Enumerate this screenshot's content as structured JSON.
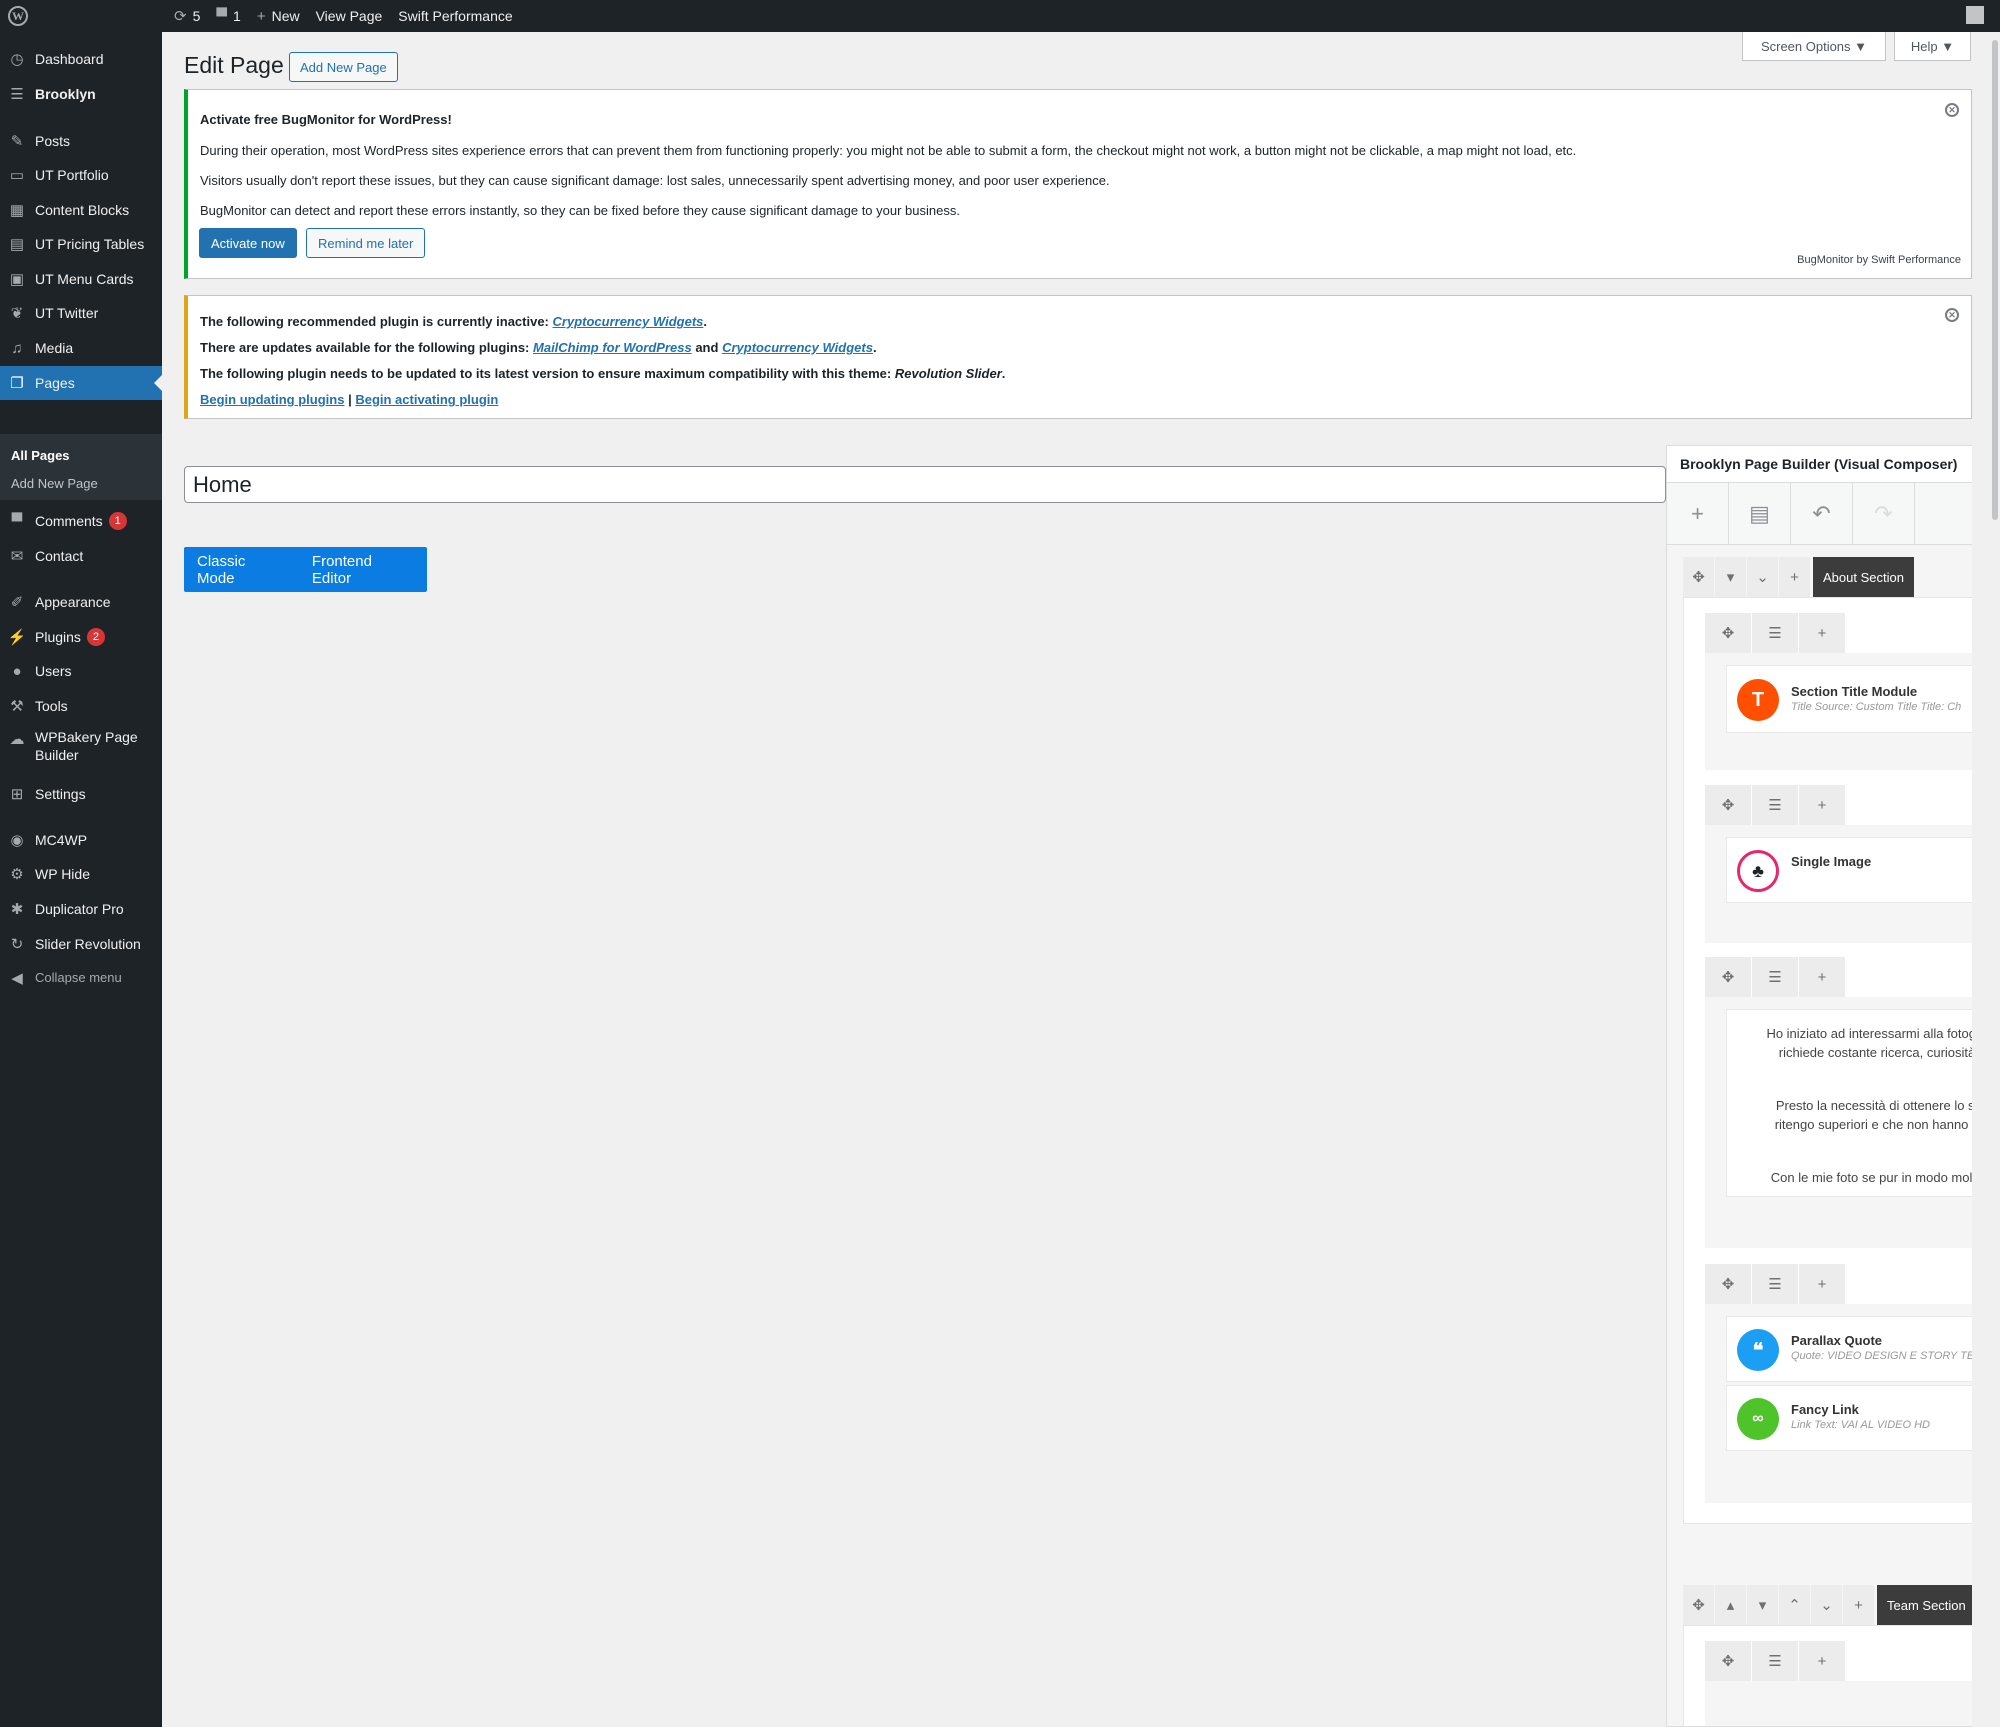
{
  "adminbar": {
    "updates_count": "5",
    "comments_count": "1",
    "new_label": "New",
    "view_page": "View Page",
    "swift": "Swift Performance"
  },
  "sidebar": {
    "items": [
      {
        "label": "Dashboard",
        "icon": "dashboard-icon"
      },
      {
        "label": "Brooklyn",
        "icon": "brooklyn-icon"
      },
      {
        "label": "Posts",
        "icon": "pin-icon"
      },
      {
        "label": "UT Portfolio",
        "icon": "portfolio-icon"
      },
      {
        "label": "Content Blocks",
        "icon": "blocks-icon"
      },
      {
        "label": "UT Pricing Tables",
        "icon": "table-icon"
      },
      {
        "label": "UT Menu Cards",
        "icon": "cards-icon"
      },
      {
        "label": "UT Twitter",
        "icon": "twitter-icon"
      },
      {
        "label": "Media",
        "icon": "media-icon"
      },
      {
        "label": "Pages",
        "icon": "pages-icon"
      },
      {
        "label": "Comments",
        "icon": "comment-icon",
        "badge": "1"
      },
      {
        "label": "Contact",
        "icon": "mail-icon"
      },
      {
        "label": "Appearance",
        "icon": "brush-icon"
      },
      {
        "label": "Plugins",
        "icon": "plugin-icon",
        "badge": "2"
      },
      {
        "label": "Users",
        "icon": "user-icon"
      },
      {
        "label": "Tools",
        "icon": "wrench-icon"
      },
      {
        "label": "WPBakery Page Builder",
        "icon": "cloud-icon"
      },
      {
        "label": "Settings",
        "icon": "settings-icon"
      },
      {
        "label": "MC4WP",
        "icon": "mc4wp-icon"
      },
      {
        "label": "WP Hide",
        "icon": "gear-icon"
      },
      {
        "label": "Duplicator Pro",
        "icon": "duplicator-icon"
      },
      {
        "label": "Slider Revolution",
        "icon": "refresh-icon"
      },
      {
        "label": "Collapse menu",
        "icon": "collapse-icon"
      }
    ],
    "submenu": [
      "All Pages",
      "Add New Page"
    ]
  },
  "header": {
    "screen_options": "Screen Options",
    "help": "Help",
    "title": "Edit Page",
    "add_new": "Add New Page"
  },
  "notice_bug": {
    "title": "Activate free BugMonitor for WordPress!",
    "p1": "During their operation, most WordPress sites experience errors that can prevent them from functioning properly: you might not be able to submit a form, the checkout might not work, a button might not be clickable, a map might not load, etc.",
    "p2": "Visitors usually don't report these issues, but they can cause significant damage: lost sales, unnecessarily spent advertising money, and poor user experience.",
    "p3": "BugMonitor can detect and report these errors instantly, so they can be fixed before they cause significant damage to your business.",
    "activate": "Activate now",
    "remind": "Remind me later",
    "brand": "BugMonitor by Swift Performance"
  },
  "notice_plugins": {
    "l1_text": "The following recommended plugin is currently inactive:",
    "l1_link": "Cryptocurrency Widgets",
    "l2_text": "There are updates available for the following plugins:",
    "l2_link1": "MailChimp for WordPress",
    "l2_and": "and",
    "l2_link2": "Cryptocurrency Widgets",
    "l3_text": "The following plugin needs to be updated to its latest version to ensure maximum compatibility with this theme:",
    "l3_plugin": "Revolution Slider",
    "link_update": "Begin updating plugins",
    "sep": "|",
    "link_activate": "Begin activating plugin"
  },
  "editor": {
    "title_value": "Home",
    "classic_mode": "Classic Mode",
    "frontend_editor": "Frontend Editor"
  },
  "page_builder": {
    "header": "Brooklyn Page Builder (Visual Composer)",
    "rows": [
      {
        "name": "About Section"
      },
      {
        "name": "Team Section"
      }
    ],
    "elements": {
      "section_title": {
        "title": "Section Title Module",
        "sub": "Title Source: Custom Title  Title: Ch"
      },
      "single_image": {
        "title": "Single Image"
      },
      "text_lines": [
        "Ho iniziato ad interessarmi alla fotogra",
        "richiede costante ricerca, curiosità",
        "Presto la necessità di ottenere lo st",
        "ritengo superiori e che non hanno a",
        "Con le mie foto se pur in modo molto"
      ],
      "parallax_quote": {
        "title": "Parallax Quote",
        "sub": "Quote: VIDEO DESIGN E STORY TE"
      },
      "fancy_link": {
        "title": "Fancy Link",
        "sub": "Link Text: VAI AL VIDEO HD"
      }
    }
  },
  "colors": {
    "admin_dark": "#1d2327",
    "wp_blue": "#2271b1",
    "success_green": "#00a32a",
    "warning_yellow": "#dba617",
    "section_title_orange": "#ff4f00",
    "image_pink": "#e8256d",
    "quote_blue": "#1b9ef3",
    "link_green": "#4ec42a"
  }
}
